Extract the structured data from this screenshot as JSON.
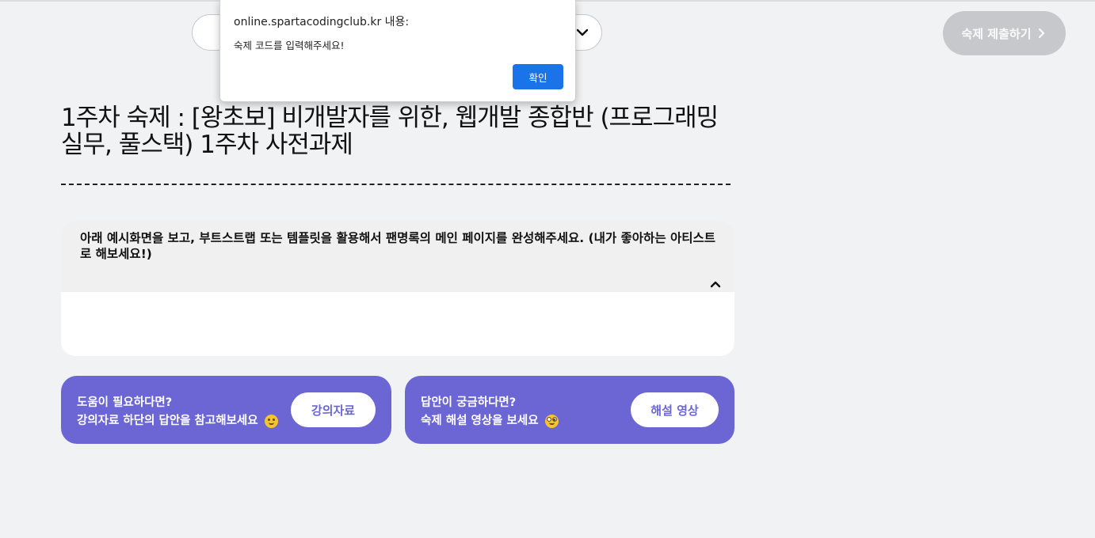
{
  "header": {
    "submit_label": "숙제 제출하기"
  },
  "dialog": {
    "origin": "online.spartacodingclub.kr 내용:",
    "message": "숙제 코드를 입력해주세요!",
    "ok_label": "확인"
  },
  "homework": {
    "title": "1주차 숙제 : [왕초보] 비개발자를 위한, 웹개발 종합반 (프로그래밍 실무, 풀스택) 1주차 사전과제",
    "description": "아래 예시화면을 보고, 부트스트랩 또는 템플릿을 활용해서 팬명록의 메인 페이지를 완성해주세요. (내가 좋아하는 아티스트로 해보세요!)"
  },
  "help": {
    "materials": {
      "line1": "도움이 필요하다면?",
      "line2": "강의자료 하단의 답안을 참고해보세요",
      "button": "강의자료",
      "emoji": "winking-face-icon"
    },
    "video": {
      "line1": "답안이 궁금하다면?",
      "line2": "숙제 해설 영상을 보세요",
      "button": "해설 영상",
      "emoji": "nerd-face-icon"
    }
  },
  "colors": {
    "background": "#f1f2f4",
    "accent": "#6b66d4",
    "dialog_button": "#1a73e8",
    "submit_disabled": "#c7c8cb"
  }
}
